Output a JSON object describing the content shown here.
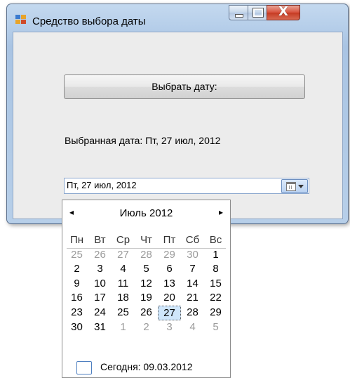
{
  "window": {
    "title": "Средство выбора даты",
    "icon": "app-form-icon",
    "controls": {
      "minimize": "minimize-icon",
      "maximize": "maximize-icon",
      "close": "close-icon",
      "close_label": "X"
    }
  },
  "main": {
    "pick_button_label": "Выбрать дату:",
    "selected_label": "Выбранная дата: Пт, 27 июл, 2012",
    "date_field_value": "Пт, 27 июл, 2012"
  },
  "calendar": {
    "prev_arrow": "◂",
    "next_arrow": "▸",
    "month_title": "Июль 2012",
    "weekdays": [
      "Пн",
      "Вт",
      "Ср",
      "Чт",
      "Пт",
      "Сб",
      "Вс"
    ],
    "weeks": [
      [
        "25",
        "26",
        "27",
        "28",
        "29",
        "30",
        "1"
      ],
      [
        "2",
        "3",
        "4",
        "5",
        "6",
        "7",
        "8"
      ],
      [
        "9",
        "10",
        "11",
        "12",
        "13",
        "14",
        "15"
      ],
      [
        "16",
        "17",
        "18",
        "19",
        "20",
        "21",
        "22"
      ],
      [
        "23",
        "24",
        "25",
        "26",
        "27",
        "28",
        "29"
      ],
      [
        "30",
        "31",
        "1",
        "2",
        "3",
        "4",
        "5"
      ]
    ],
    "today_label": "Сегодня: 09.03.2012"
  },
  "colors": {
    "accent": "#3c7fb1",
    "selected_day_bg": "#cfe6fb",
    "muted_day": "#9b9b9b"
  }
}
